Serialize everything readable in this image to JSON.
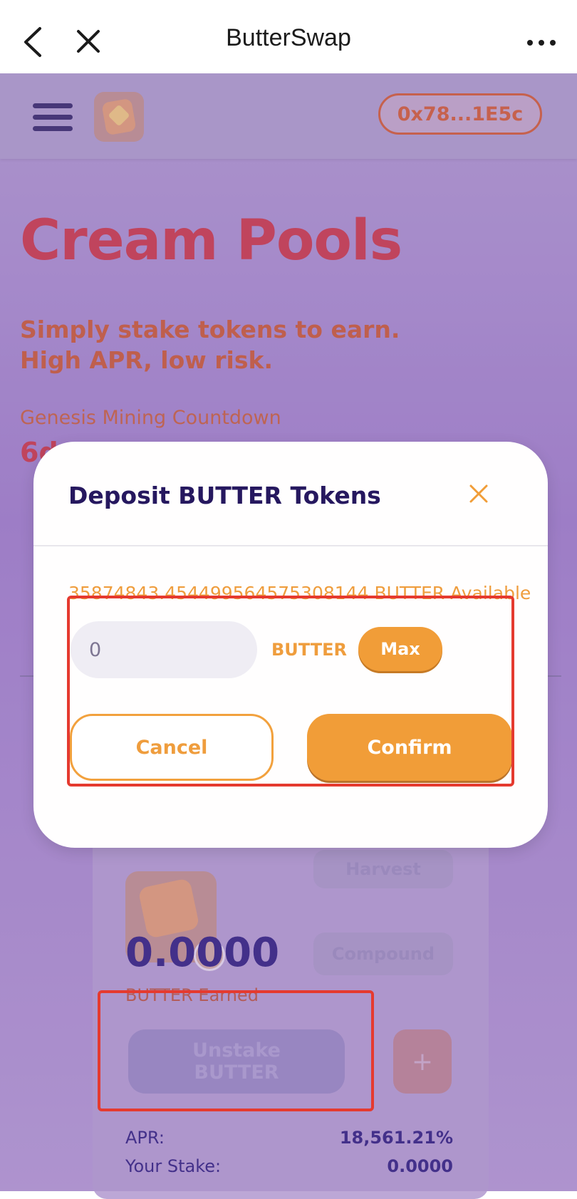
{
  "browser": {
    "title": "ButterSwap"
  },
  "header": {
    "wallet_address": "0x78...1E5c"
  },
  "hero": {
    "title": "Cream Pools",
    "subtitle_line1": "Simply stake tokens to earn.",
    "subtitle_line2": "High APR, low risk.",
    "countdown_label": "Genesis Mining Countdown",
    "countdown_value": "6d"
  },
  "pool_card": {
    "harvest_label": "Harvest",
    "compound_label": "Compound",
    "earned_value": "0.0000",
    "earned_label": "BUTTER Earned",
    "unstake_line1": "Unstake",
    "unstake_line2": "BUTTER",
    "plus_label": "+",
    "stats": [
      {
        "label": "APR:",
        "value": "18,561.21%"
      },
      {
        "label": "Your Stake:",
        "value": "0.0000"
      }
    ]
  },
  "modal": {
    "title": "Deposit BUTTER Tokens",
    "available": "35874843.454499564575308144 BUTTER Available",
    "input_value": "0",
    "unit": "BUTTER",
    "max_label": "Max",
    "cancel_label": "Cancel",
    "confirm_label": "Confirm"
  },
  "colors": {
    "accent": "#f19d38",
    "dark_text": "#26185f",
    "highlight": "#e53a2f"
  }
}
